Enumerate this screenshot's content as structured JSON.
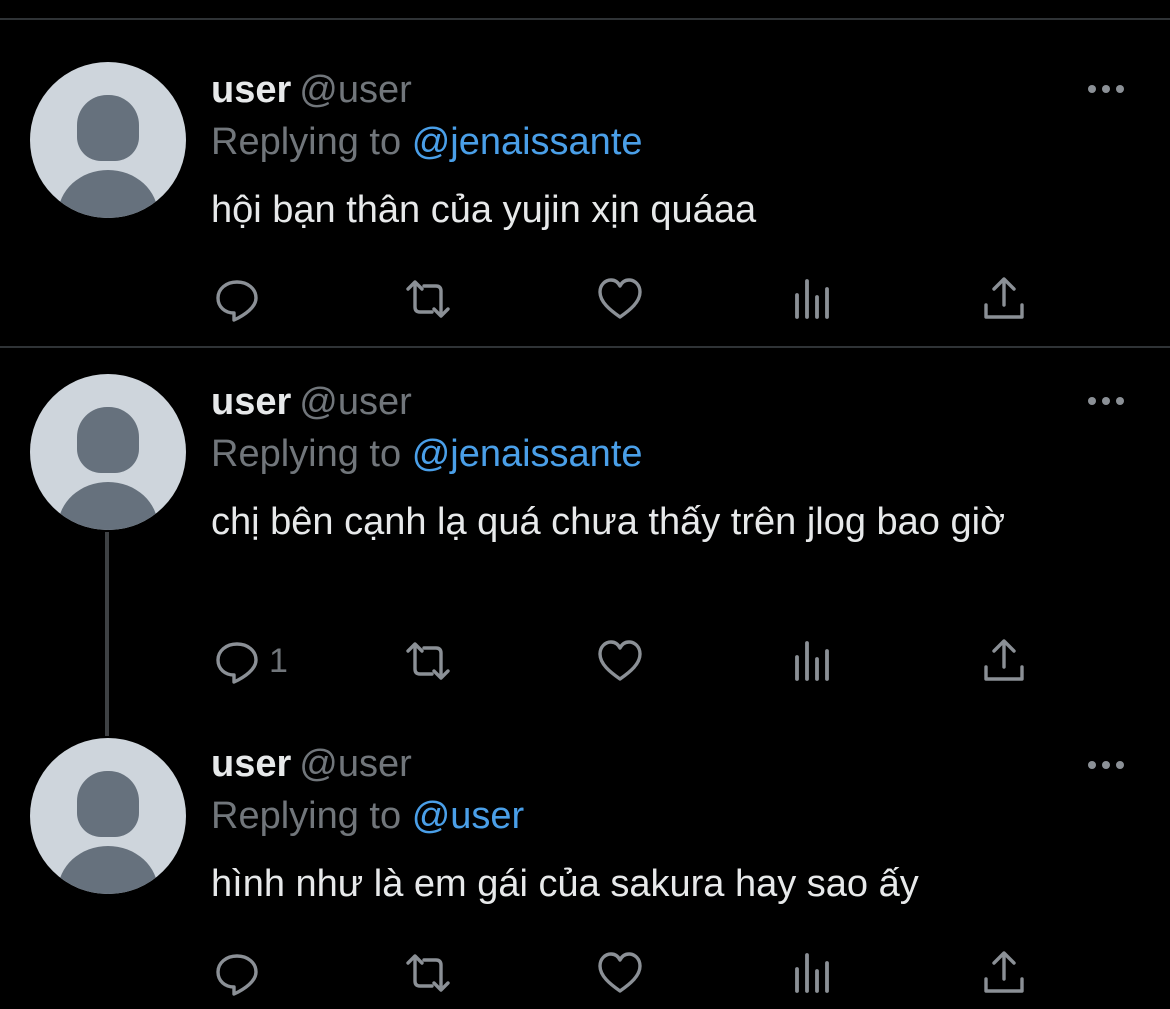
{
  "tweets": [
    {
      "name": "user",
      "handle": "@user",
      "replying_label": "Replying to",
      "replying_to": "@jenaissante",
      "text": "hội bạn thân của yujin xịn quáaa",
      "reply_count": ""
    },
    {
      "name": "user",
      "handle": "@user",
      "replying_label": "Replying to",
      "replying_to": "@jenaissante",
      "text": "chị bên cạnh lạ quá chưa thấy trên jlog bao giờ",
      "reply_count": "1"
    },
    {
      "name": "user",
      "handle": "@user",
      "replying_label": "Replying to",
      "replying_to": "@user",
      "text": "hình như là em gái của sakura hay sao ấy",
      "reply_count": ""
    }
  ],
  "icons": {
    "reply": "reply-icon",
    "retweet": "retweet-icon",
    "like": "heart-icon",
    "views": "views-icon",
    "share": "share-icon",
    "more": "more-icon",
    "avatar": "default-avatar"
  },
  "colors": {
    "background": "#000000",
    "text": "#e7e9ea",
    "secondary": "#71767b",
    "link": "#4a9fe8",
    "avatar_bg": "#ced5dc",
    "avatar_fg": "#66717d",
    "divider": "#2f3336"
  }
}
